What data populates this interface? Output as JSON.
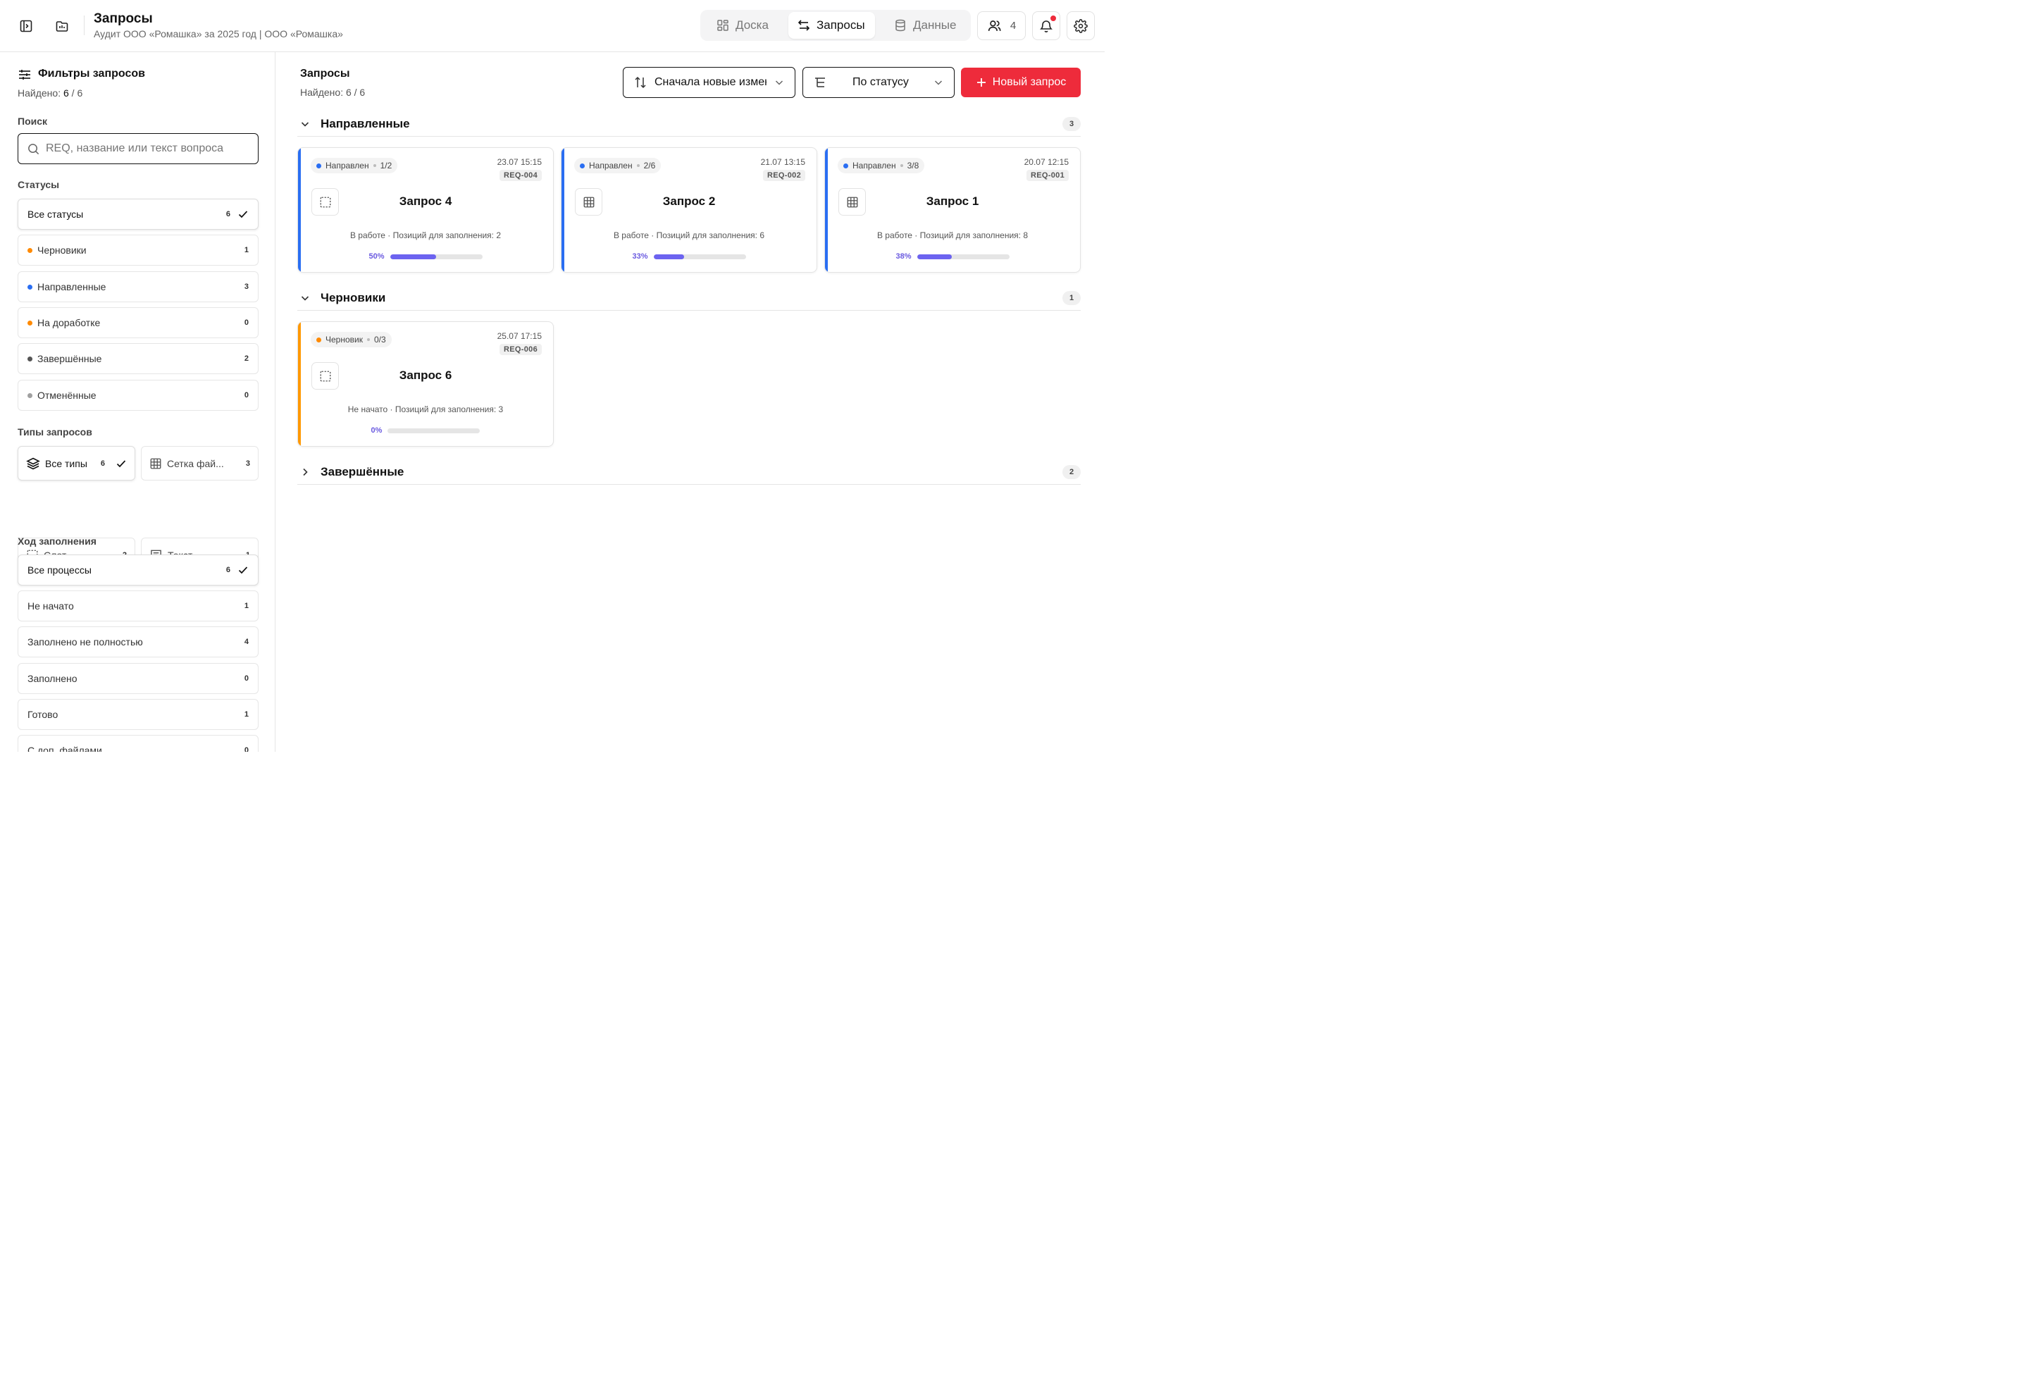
{
  "header": {
    "title": "Запросы",
    "subtitle": "Аудит ООО «Ромашка» за 2025 год | ООО «Ромашка»",
    "nav": [
      {
        "label": "Доска",
        "icon": "board-icon"
      },
      {
        "label": "Запросы",
        "icon": "arrows-swap-icon",
        "active": true
      },
      {
        "label": "Данные",
        "icon": "database-icon"
      }
    ],
    "users_count": "4"
  },
  "sidebar": {
    "title": "Фильтры запросов",
    "found_label": "Найдено:",
    "found_value": "6",
    "found_total": "/ 6",
    "search": {
      "label": "Поиск",
      "placeholder": "REQ, название или текст вопроса"
    },
    "statuses": {
      "label": "Статусы",
      "items": [
        {
          "label": "Все статусы",
          "count": "6",
          "selected": true
        },
        {
          "label": "Черновики",
          "count": "1",
          "color": "#ff8a00"
        },
        {
          "label": "Направленные",
          "count": "3",
          "color": "#2a6ef2"
        },
        {
          "label": "На доработке",
          "count": "0",
          "color": "#ff8a00"
        },
        {
          "label": "Завершённые",
          "count": "2",
          "color": "#555555"
        },
        {
          "label": "Отменённые",
          "count": "0",
          "color": "#a0a0a0"
        }
      ]
    },
    "types": {
      "label": "Типы запросов",
      "items": [
        {
          "label": "Все типы",
          "count": "6",
          "selected": true,
          "icon": "layers-icon"
        },
        {
          "label": "Сетка фай...",
          "count": "3",
          "icon": "grid-icon"
        },
        {
          "label": "Слот",
          "count": "2",
          "icon": "slot-icon"
        },
        {
          "label": "Текст",
          "count": "1",
          "icon": "text-message-icon"
        }
      ]
    },
    "progress": {
      "label": "Ход заполнения",
      "items": [
        {
          "label": "Все процессы",
          "count": "6",
          "selected": true
        },
        {
          "label": "Не начато",
          "count": "1"
        },
        {
          "label": "Заполнено не полностью",
          "count": "4"
        },
        {
          "label": "Заполнено",
          "count": "0"
        },
        {
          "label": "Готово",
          "count": "1"
        },
        {
          "label": "С доп. файлами",
          "count": "0"
        }
      ]
    }
  },
  "main": {
    "title": "Запросы",
    "found": "Найдено: 6 / 6",
    "sort_label": "Сначала новые изменения",
    "group_label": "По статусу",
    "new_button": "Новый запрос",
    "groups": [
      {
        "title": "Направленные",
        "count": "3",
        "expanded": true,
        "cards": [
          {
            "status": "Направлен",
            "status_color": "#2a6ef2",
            "ratio": "1/2",
            "date": "23.07 15:15",
            "req": "REQ-004",
            "icon": "slot-icon",
            "name": "Запрос 4",
            "info": "В работе · Позиций для заполнения: 2",
            "progress_label": "50%",
            "progress": 0.5,
            "bar_color": "#2a6ef2"
          },
          {
            "status": "Направлен",
            "status_color": "#2a6ef2",
            "ratio": "2/6",
            "date": "21.07 13:15",
            "req": "REQ-002",
            "icon": "grid-icon",
            "name": "Запрос 2",
            "info": "В работе · Позиций для заполнения: 6",
            "progress_label": "33%",
            "progress": 0.33,
            "bar_color": "#2a6ef2"
          },
          {
            "status": "Направлен",
            "status_color": "#2a6ef2",
            "ratio": "3/8",
            "date": "20.07 12:15",
            "req": "REQ-001",
            "icon": "grid-icon",
            "name": "Запрос 1",
            "info": "В работе · Позиций для заполнения: 8",
            "progress_label": "38%",
            "progress": 0.38,
            "bar_color": "#2a6ef2"
          }
        ]
      },
      {
        "title": "Черновики",
        "count": "1",
        "expanded": true,
        "cards": [
          {
            "status": "Черновик",
            "status_color": "#ff8a00",
            "ratio": "0/3",
            "date": "25.07 17:15",
            "req": "REQ-006",
            "icon": "slot-icon",
            "name": "Запрос 6",
            "info": "Не начато · Позиций для заполнения: 3",
            "progress_label": "0%",
            "progress": 0,
            "bar_color": "#ff9800"
          }
        ]
      },
      {
        "title": "Завершённые",
        "count": "2",
        "expanded": false,
        "cards": []
      }
    ]
  }
}
